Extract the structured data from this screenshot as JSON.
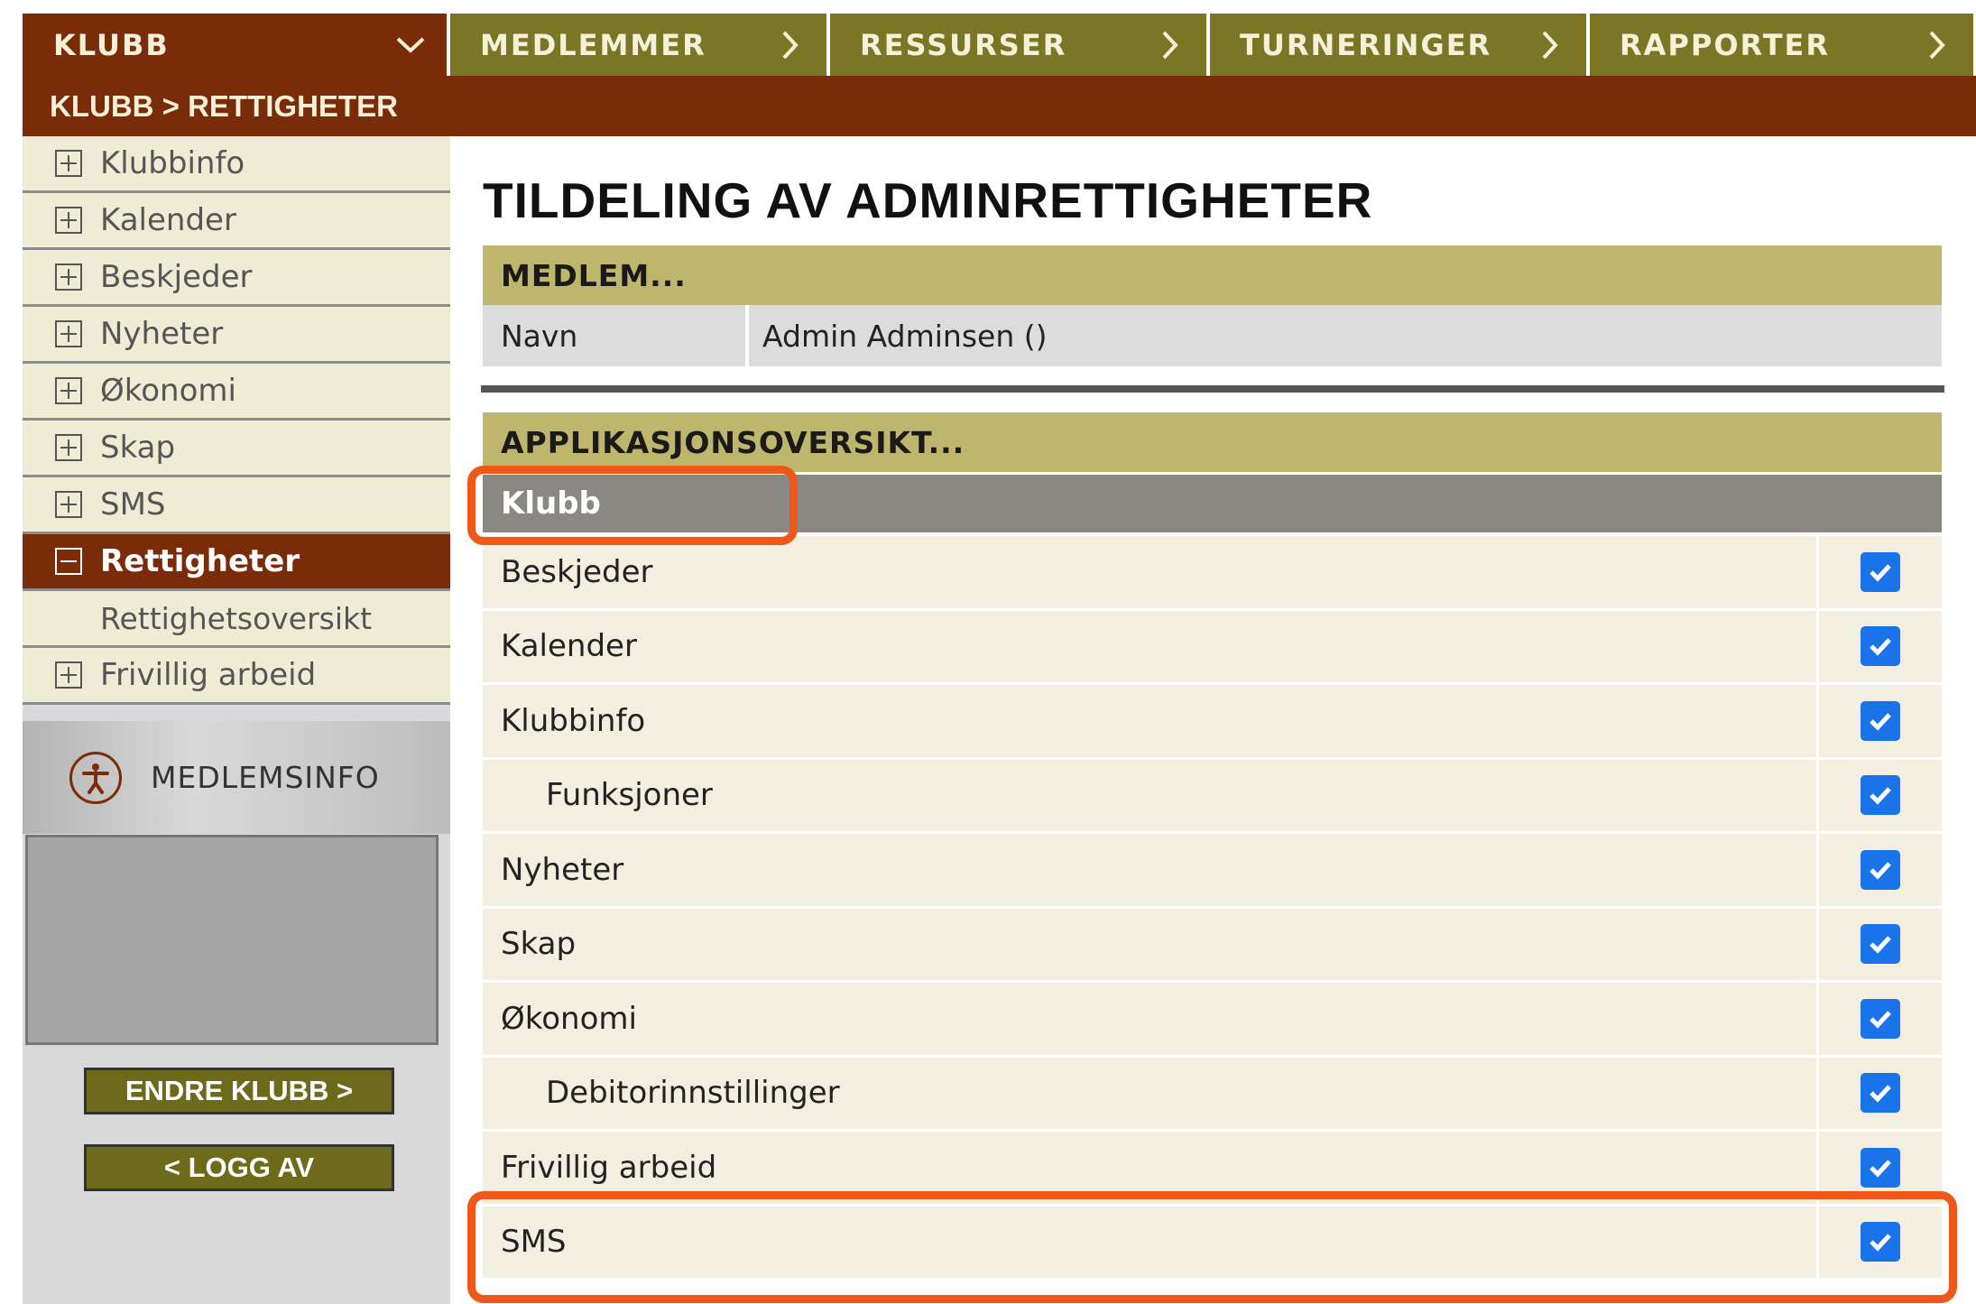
{
  "topnav": {
    "items": [
      {
        "label": "KLUBB",
        "icon": "chevron-down-icon"
      },
      {
        "label": "MEDLEMMER",
        "icon": "chevron-right-icon"
      },
      {
        "label": "RESSURSER",
        "icon": "chevron-right-icon"
      },
      {
        "label": "TURNERINGER",
        "icon": "chevron-right-icon"
      },
      {
        "label": "RAPPORTER",
        "icon": "chevron-right-icon"
      }
    ]
  },
  "breadcrumb": "KLUBB > RETTIGHETER",
  "sidebar": {
    "items": [
      {
        "label": "Klubbinfo",
        "expanded": false
      },
      {
        "label": "Kalender",
        "expanded": false
      },
      {
        "label": "Beskjeder",
        "expanded": false
      },
      {
        "label": "Nyheter",
        "expanded": false
      },
      {
        "label": "Økonomi",
        "expanded": false
      },
      {
        "label": "Skap",
        "expanded": false
      },
      {
        "label": "SMS",
        "expanded": false
      },
      {
        "label": "Rettigheter",
        "expanded": true,
        "active": true
      },
      {
        "label": "Rettighetsoversikt",
        "sub": true
      },
      {
        "label": "Frivillig arbeid",
        "expanded": false
      }
    ],
    "medlemsinfo_label": "MEDLEMSINFO",
    "buttons": {
      "change_club": "ENDRE KLUBB >",
      "logout": "< LOGG AV"
    }
  },
  "main": {
    "title": "TILDELING AV ADMINRETTIGHETER",
    "member_section": {
      "heading": "MEDLEM...",
      "field_label": "Navn",
      "field_value": "Admin Adminsen ()"
    },
    "app_section": {
      "heading": "APPLIKASJONSOVERSIKT...",
      "group": "Klubb",
      "permissions": [
        {
          "label": "Beskjeder",
          "checked": true,
          "indent": false
        },
        {
          "label": "Kalender",
          "checked": true,
          "indent": false
        },
        {
          "label": "Klubbinfo",
          "checked": true,
          "indent": false
        },
        {
          "label": "Funksjoner",
          "checked": true,
          "indent": true
        },
        {
          "label": "Nyheter",
          "checked": true,
          "indent": false
        },
        {
          "label": "Skap",
          "checked": true,
          "indent": false
        },
        {
          "label": "Økonomi",
          "checked": true,
          "indent": false
        },
        {
          "label": "Debitorinnstillinger",
          "checked": true,
          "indent": true
        },
        {
          "label": "Frivillig arbeid",
          "checked": true,
          "indent": false
        },
        {
          "label": "SMS",
          "checked": true,
          "indent": false
        }
      ]
    }
  },
  "colors": {
    "primary_brown": "#7a2b08",
    "olive": "#7a7625",
    "section_khaki": "#bdb66c",
    "group_gray": "#8a8882",
    "checkbox_blue": "#1a73e8",
    "highlight_orange": "#f0581a"
  }
}
